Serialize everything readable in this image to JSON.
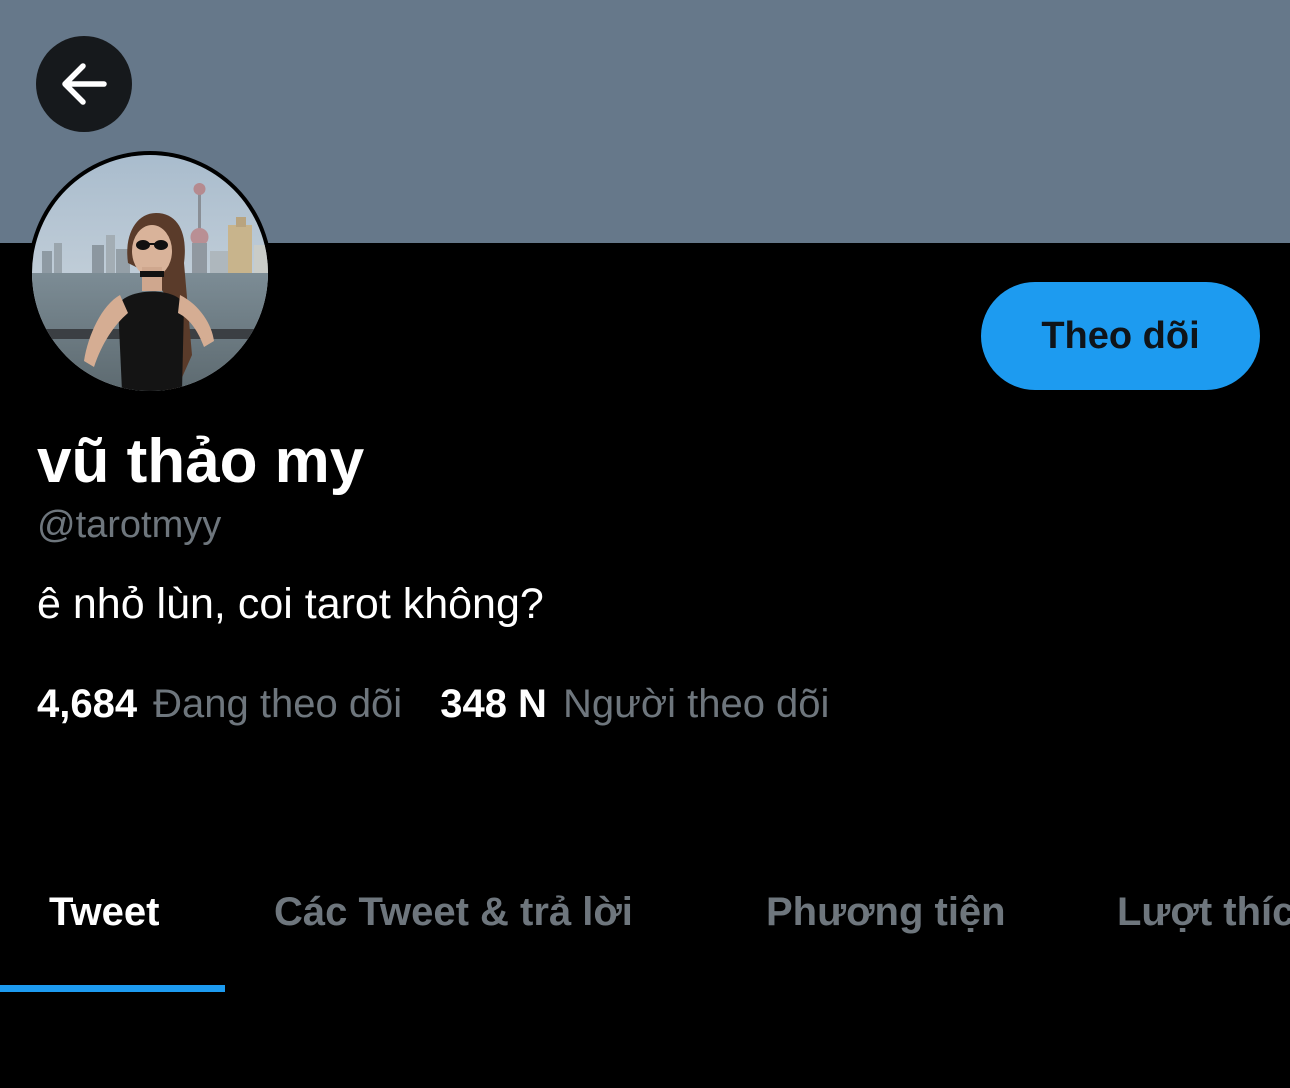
{
  "colors": {
    "banner": "#66788a",
    "accent": "#1d9bf0",
    "background": "#000000",
    "secondary_text": "#6e767d"
  },
  "header": {
    "back_icon": "arrow-left-icon"
  },
  "profile": {
    "display_name": "vũ thảo my",
    "handle": "@tarotmyy",
    "bio": "ê nhỏ lùn, coi tarot không?",
    "follow_label": "Theo dõi"
  },
  "stats": {
    "following_count": "4,684",
    "following_label": "Đang theo dõi",
    "followers_count": "348 N",
    "followers_label": "Người theo dõi"
  },
  "tabs": [
    {
      "label": "Tweet",
      "active": true
    },
    {
      "label": "Các Tweet & trả lời",
      "active": false
    },
    {
      "label": "Phương tiện",
      "active": false
    },
    {
      "label": "Lượt thích",
      "active": false
    }
  ]
}
